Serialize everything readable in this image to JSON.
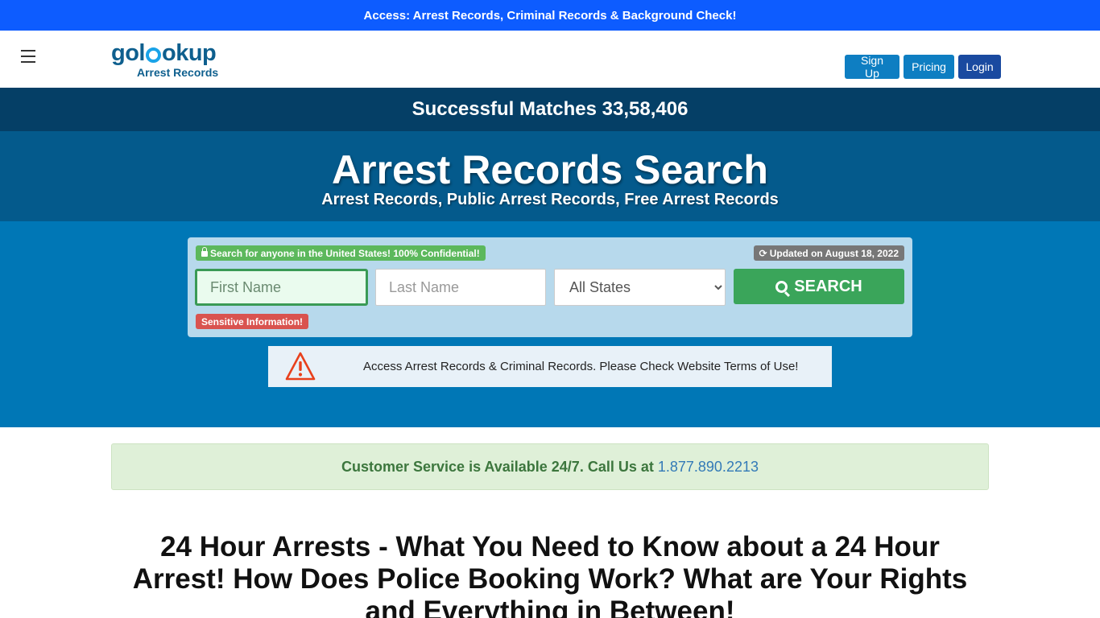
{
  "top_banner": "Access: Arrest Records, Criminal Records & Background Check!",
  "logo": {
    "main_left": "gol",
    "main_right": "okup",
    "sub": "Arrest Records"
  },
  "nav": {
    "signup": "Sign Up",
    "pricing": "Pricing",
    "login": "Login"
  },
  "matches": "Successful Matches 33,58,406",
  "hero": {
    "title": "Arrest Records Search",
    "subtitle": "Arrest Records, Public Arrest Records, Free Arrest Records"
  },
  "search": {
    "confidential_badge": "Search for anyone in the United States! 100% Confidential!",
    "updated_badge": "Updated on August 18, 2022",
    "first_name_placeholder": "First Name",
    "last_name_placeholder": "Last Name",
    "state_selected": "All States",
    "button": "SEARCH",
    "sensitive_badge": "Sensitive Information!"
  },
  "notice": "Access Arrest Records & Criminal Records. Please Check Website Terms of Use!",
  "customer_service": {
    "text": "Customer Service is Available 24/7. Call Us at",
    "phone": "1.877.890.2213"
  },
  "article": {
    "title": "24 Hour Arrests - What You Need to Know about a 24 Hour Arrest! How Does Police Booking Work? What are Your Rights and Everything in Between!"
  },
  "colors": {
    "top_banner": "#0d5cff",
    "matches_bar": "#053f66",
    "hero_band": "#045a8c",
    "search_band": "#0077b6",
    "search_button": "#3aa55a",
    "sensitive": "#d9534f"
  }
}
